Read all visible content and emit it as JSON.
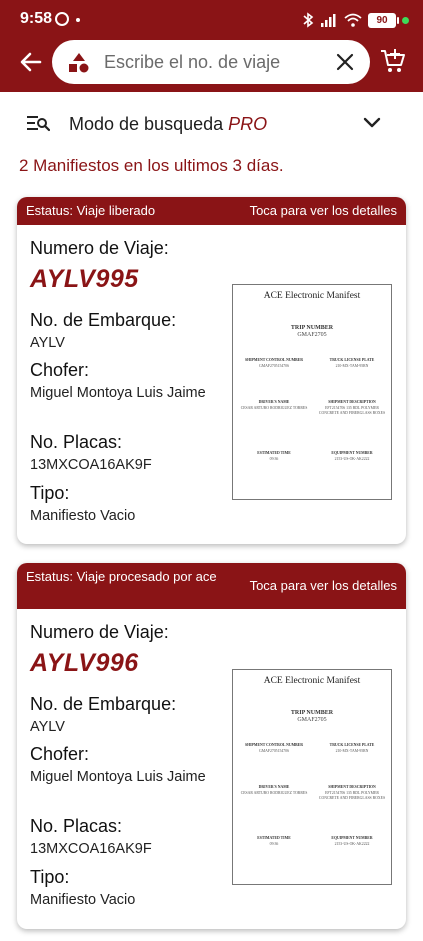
{
  "status_bar": {
    "time": "9:58",
    "battery": "90"
  },
  "search": {
    "placeholder": "Escribe el no. de viaje"
  },
  "search_mode": {
    "label": "Modo de busqueda",
    "mode": "PRO"
  },
  "summary_text": "2 Manifiestos en los ultimos 3 días.",
  "labels": {
    "trip_number": "Numero de Viaje:",
    "shipment_number": "No. de Embarque:",
    "driver": "Chofer:",
    "plates": "No. Placas:",
    "type": "Tipo:"
  },
  "card_hint": "Toca para ver los detalles",
  "manifest_preview": {
    "title": "ACE Electronic Manifest",
    "trip_number_heading": "TRIP NUMBER",
    "trip_number_value": "GMAF2705",
    "shipment_control_heading": "SHIPMENT CONTROL NUMBER",
    "shipment_control_value": "GMAF2705154706",
    "truck_plate_heading": "TRUCK LICENSE PLATE",
    "truck_plate_value": "210-MX-TAM-95RN",
    "driver_heading": "DRIVER'S NAME",
    "driver_value": "CESAR ARTURO RODRIGUEZ TORRES",
    "shipment_desc_heading": "SHIPMENT DESCRIPTION",
    "shipment_desc_value": "EFT2154706 135 BDL POLYMER CONCRETE AND FIBERGLASS BOXES",
    "est_time_heading": "ESTIMATED TIME",
    "est_time_value": "09:36",
    "equipment_heading": "EQUIPMENT NUMBER",
    "equipment_value": "2153-US-OK-AK2222"
  },
  "manifests": [
    {
      "status": "Estatus: Viaje liberado",
      "trip_number": "AYLV995",
      "shipment_number": "AYLV",
      "driver": "Miguel Montoya Luis Jaime",
      "plates": "13MXCOA16AK9F",
      "type": "Manifiesto Vacio"
    },
    {
      "status": "Estatus: Viaje  procesado por ace",
      "trip_number": "AYLV996",
      "shipment_number": "AYLV",
      "driver": "Miguel Montoya Luis Jaime",
      "plates": "13MXCOA16AK9F",
      "type": "Manifiesto Vacio"
    }
  ]
}
